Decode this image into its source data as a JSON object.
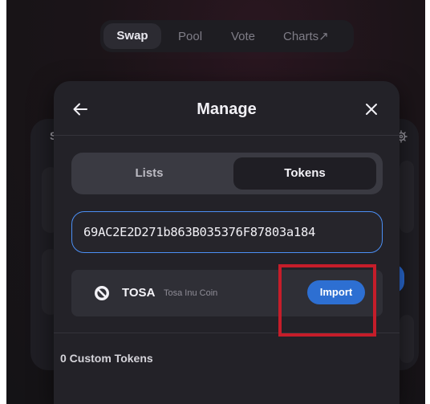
{
  "nav": {
    "items": [
      {
        "label": "Swap",
        "active": true
      },
      {
        "label": "Pool"
      },
      {
        "label": "Vote"
      },
      {
        "label": "Charts↗"
      }
    ]
  },
  "background_card": {
    "letter": "S"
  },
  "modal": {
    "title": "Manage",
    "tabs": [
      {
        "label": "Lists"
      },
      {
        "label": "Tokens",
        "selected": true
      }
    ],
    "search": {
      "value": "69AC2E2D271b863B035376F87803a184"
    },
    "result": {
      "symbol": "TOSA",
      "name": "Tosa Inu Coin",
      "import_label": "Import"
    },
    "custom_tokens_label": "0 Custom Tokens"
  },
  "colors": {
    "accent": "#2d6fd2",
    "focus_border": "#4b8ff5",
    "highlight": "#c51d2a",
    "modal_bg": "#232228"
  },
  "icons": {
    "back": "arrow-left-icon",
    "close": "close-icon",
    "token": "no-entry-icon",
    "settings": "gear-icon"
  }
}
